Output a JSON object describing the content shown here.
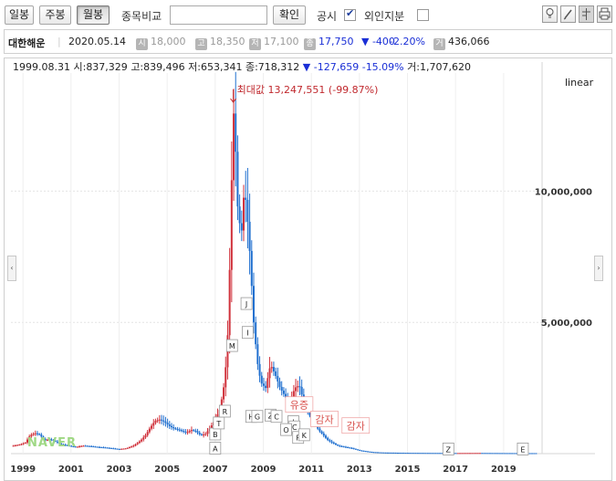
{
  "toolbar": {
    "period_buttons": [
      "일봉",
      "주봉",
      "월봉"
    ],
    "active_period": "월봉",
    "compare_label": "종목비교",
    "compare_input_value": "",
    "confirm_label": "확인",
    "disclosure_label": "공시",
    "disclosure_checked": true,
    "foreign_label": "외인지분",
    "foreign_checked": false,
    "tool_icons": [
      "bulb-icon",
      "pencil-icon",
      "crosshair-icon",
      "print-icon"
    ]
  },
  "stock": {
    "name": "대한해운",
    "date": "2020.05.14",
    "open_badge": "시",
    "open": "18,000",
    "high_badge": "고",
    "high": "18,350",
    "low_badge": "저",
    "low": "17,100",
    "close_badge": "종",
    "close": "17,750",
    "change": "▼ -400",
    "change_pct": "-2.20%",
    "volume_badge": "거",
    "volume": "436,066"
  },
  "ohlc_line": {
    "date": "1999.08.31",
    "open_label": "시:",
    "open": "837,329",
    "high_label": "고:",
    "high": "839,496",
    "low_label": "저:",
    "low": "653,341",
    "close_label": "종:",
    "close": "718,312",
    "change": "▼ -127,659",
    "change_pct": "-15.09%",
    "volume_label": "거:",
    "volume": "1,707,620"
  },
  "scale_label": "linear",
  "max_annotation": "최대값 13,247,551 (-99.87%)",
  "watermark": "NAVER",
  "colors": {
    "up": "#d0313b",
    "down": "#1f6fcf",
    "accent_red": "#c0282d",
    "accent_blue": "#1a2fd6"
  },
  "chart_data": {
    "type": "bar",
    "subtype": "ohlc-monthly",
    "xlabel": "",
    "ylabel": "",
    "x_ticks": [
      "1999",
      "2001",
      "2003",
      "2005",
      "2007",
      "2009",
      "2011",
      "2013",
      "2015",
      "2017",
      "2019"
    ],
    "y_ticks": [
      {
        "value": 5000000,
        "label": "5,000,000"
      },
      {
        "value": 10000000,
        "label": "10,000,000"
      }
    ],
    "ylim": [
      0,
      14500000
    ],
    "xlim": [
      1998.5,
      2020.6
    ],
    "max_value": 13247551,
    "max_date": 2007.75,
    "series": [
      {
        "name": "",
        "points": [
          [
            1998.6,
            300000
          ],
          [
            1998.9,
            350000
          ],
          [
            1999.1,
            420000
          ],
          [
            1999.3,
            700000
          ],
          [
            1999.5,
            780000
          ],
          [
            1999.7,
            720000
          ],
          [
            1999.9,
            500000
          ],
          [
            2000.1,
            550000
          ],
          [
            2000.3,
            480000
          ],
          [
            2000.6,
            350000
          ],
          [
            2000.9,
            300000
          ],
          [
            2001.2,
            250000
          ],
          [
            2001.5,
            300000
          ],
          [
            2001.8,
            280000
          ],
          [
            2002.1,
            250000
          ],
          [
            2002.4,
            230000
          ],
          [
            2002.7,
            200000
          ],
          [
            2003.0,
            170000
          ],
          [
            2003.3,
            200000
          ],
          [
            2003.6,
            300000
          ],
          [
            2003.9,
            500000
          ],
          [
            2004.1,
            700000
          ],
          [
            2004.3,
            1000000
          ],
          [
            2004.5,
            1250000
          ],
          [
            2004.7,
            1300000
          ],
          [
            2004.9,
            1200000
          ],
          [
            2005.1,
            1050000
          ],
          [
            2005.3,
            950000
          ],
          [
            2005.5,
            900000
          ],
          [
            2005.8,
            800000
          ],
          [
            2006.0,
            900000
          ],
          [
            2006.2,
            850000
          ],
          [
            2006.4,
            700000
          ],
          [
            2006.6,
            750000
          ],
          [
            2006.8,
            1000000
          ],
          [
            2007.0,
            1300000
          ],
          [
            2007.2,
            1700000
          ],
          [
            2007.4,
            2800000
          ],
          [
            2007.55,
            5000000
          ],
          [
            2007.65,
            9000000
          ],
          [
            2007.75,
            13247551
          ],
          [
            2007.85,
            11500000
          ],
          [
            2007.95,
            9000000
          ],
          [
            2008.1,
            8500000
          ],
          [
            2008.2,
            10000000
          ],
          [
            2008.3,
            9500000
          ],
          [
            2008.45,
            7500000
          ],
          [
            2008.6,
            5000000
          ],
          [
            2008.75,
            3500000
          ],
          [
            2008.9,
            2700000
          ],
          [
            2009.1,
            2500000
          ],
          [
            2009.3,
            3400000
          ],
          [
            2009.5,
            3000000
          ],
          [
            2009.7,
            2500000
          ],
          [
            2009.9,
            2200000
          ],
          [
            2010.1,
            1800000
          ],
          [
            2010.3,
            2500000
          ],
          [
            2010.5,
            2600000
          ],
          [
            2010.7,
            1900000
          ],
          [
            2010.9,
            1500000
          ],
          [
            2011.1,
            1200000
          ],
          [
            2011.3,
            900000
          ],
          [
            2011.5,
            700000
          ],
          [
            2011.7,
            500000
          ],
          [
            2011.9,
            400000
          ],
          [
            2012.1,
            300000
          ],
          [
            2012.4,
            250000
          ],
          [
            2012.7,
            200000
          ],
          [
            2013.0,
            120000
          ],
          [
            2013.5,
            60000
          ],
          [
            2014.0,
            40000
          ],
          [
            2015.0,
            30000
          ],
          [
            2016.0,
            25000
          ],
          [
            2017.0,
            22000
          ],
          [
            2018.0,
            25000
          ],
          [
            2019.0,
            20000
          ],
          [
            2020.0,
            18000
          ],
          [
            2020.4,
            17750
          ]
        ]
      }
    ],
    "annotations": [
      {
        "text": "A",
        "x": 2007.0,
        "y": 190000
      },
      {
        "text": "B",
        "x": 2007.0,
        "y": 730000
      },
      {
        "text": "T",
        "x": 2007.15,
        "y": 1150000
      },
      {
        "text": "R",
        "x": 2007.4,
        "y": 1600000
      },
      {
        "text": "M",
        "x": 2007.7,
        "y": 4100000
      },
      {
        "text": "J",
        "x": 2008.3,
        "y": 5700000
      },
      {
        "text": "I",
        "x": 2008.35,
        "y": 4600000
      },
      {
        "text": "H",
        "x": 2008.5,
        "y": 1400000
      },
      {
        "text": "G",
        "x": 2008.75,
        "y": 1400000
      },
      {
        "text": "Z",
        "x": 2009.3,
        "y": 1450000
      },
      {
        "text": "C",
        "x": 2009.55,
        "y": 1400000
      },
      {
        "text": "I",
        "x": 2010.25,
        "y": 1200000
      },
      {
        "text": "C",
        "x": 2010.3,
        "y": 1000000
      },
      {
        "text": "O",
        "x": 2009.95,
        "y": 900000
      },
      {
        "text": "F",
        "x": 2010.45,
        "y": 600000
      },
      {
        "text": "K",
        "x": 2010.7,
        "y": 700000
      },
      {
        "text": "Z",
        "x": 2016.7,
        "y": 160000
      },
      {
        "text": "E",
        "x": 2019.8,
        "y": 160000
      }
    ],
    "capital_events": [
      {
        "text": "유증",
        "x": 2010.0,
        "y": 1750000
      },
      {
        "text": "감자",
        "x": 2011.05,
        "y": 1200000
      },
      {
        "text": "감자",
        "x": 2012.35,
        "y": 950000
      }
    ]
  }
}
